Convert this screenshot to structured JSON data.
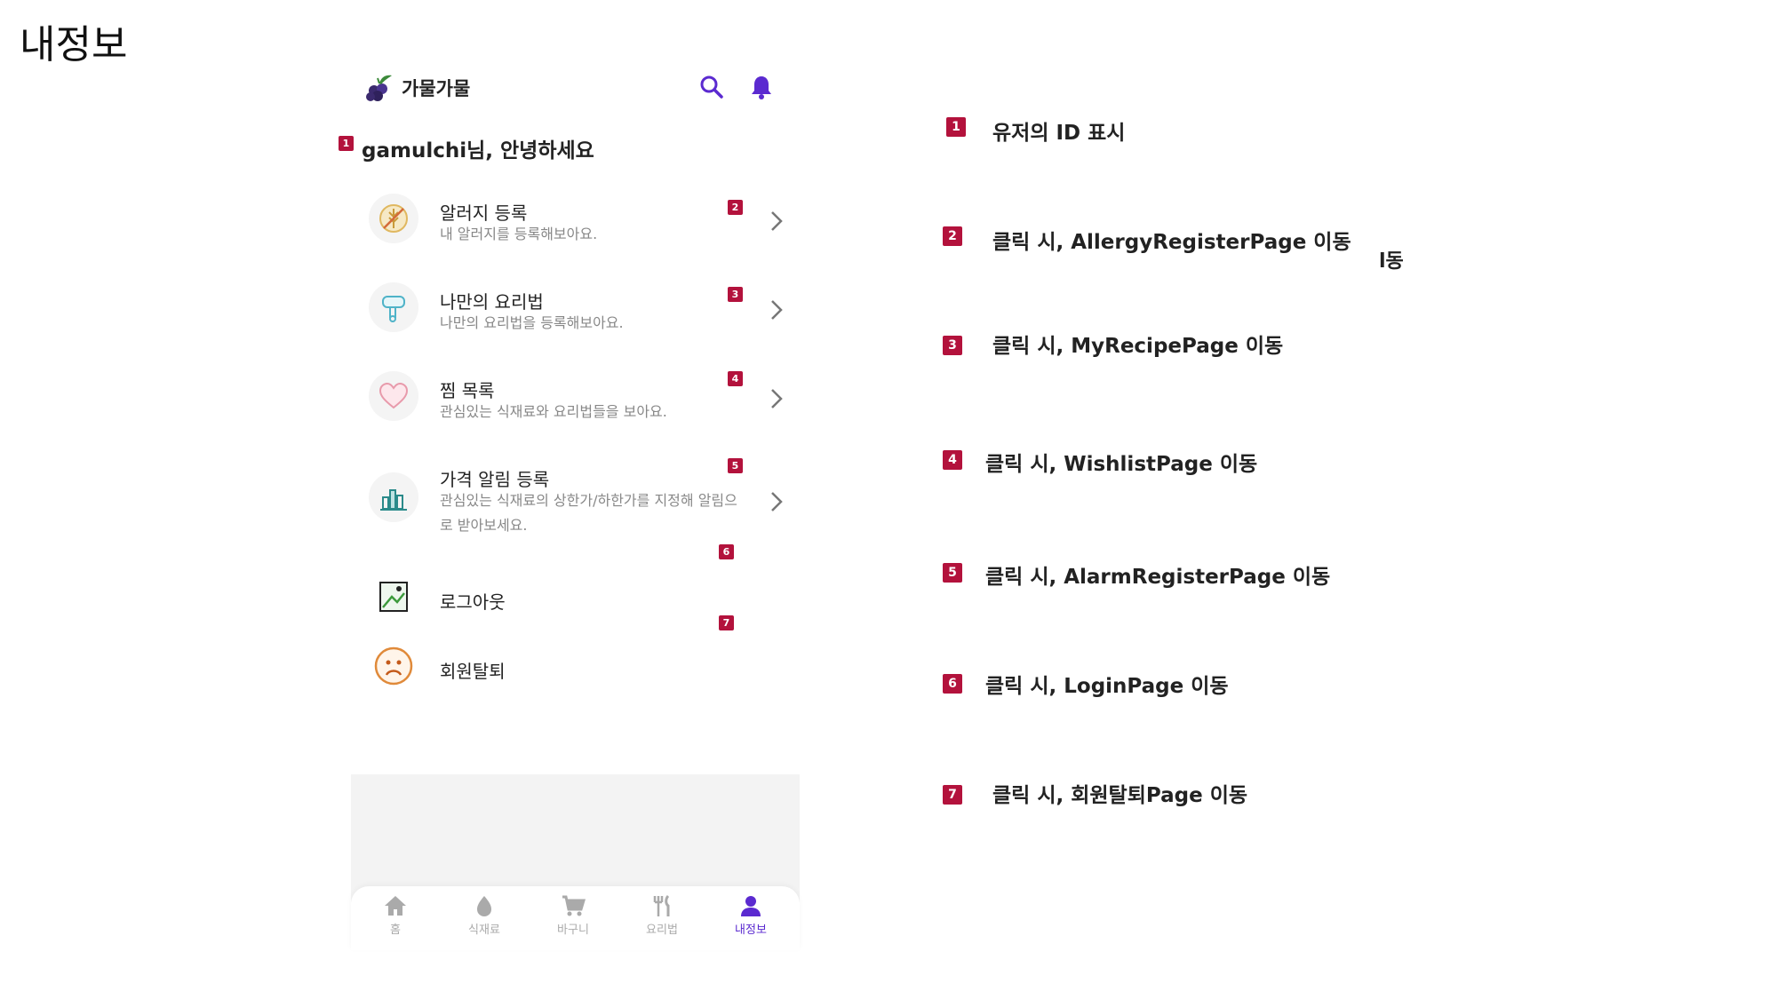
{
  "slide": {
    "title": "내정보"
  },
  "app": {
    "name": "가물가물",
    "greeting": "gamulchi님, 안녕하세요",
    "greeting_badge": "1"
  },
  "menu": [
    {
      "title": "알러지 등록",
      "subtitle": "내 알러지를 등록해보아요.",
      "badge": "2"
    },
    {
      "title": "나만의 요리법",
      "subtitle": "나만의 요리법을 등록해보아요.",
      "badge": "3"
    },
    {
      "title": "찜 목록",
      "subtitle": "관심있는 식재료와 요리법들을 보아요.",
      "badge": "4"
    },
    {
      "title": "가격 알림 등록",
      "subtitle": "관심있는 식재료의 상한가/하한가를 지정해 알림으로 받아보세요.",
      "badge": "5"
    },
    {
      "title": "로그아웃",
      "subtitle": "",
      "badge": "6"
    },
    {
      "title": "회원탈퇴",
      "subtitle": "",
      "badge": "7"
    }
  ],
  "tabs": [
    {
      "label": "홈",
      "icon": "home-icon"
    },
    {
      "label": "식재료",
      "icon": "ingredient-icon"
    },
    {
      "label": "바구니",
      "icon": "cart-icon"
    },
    {
      "label": "요리법",
      "icon": "utensils-icon"
    },
    {
      "label": "내정보",
      "icon": "user-icon",
      "active": true
    }
  ],
  "annotations": [
    {
      "badge": "1",
      "text": "유저의 ID 표시"
    },
    {
      "badge": "2",
      "text": "클릭 시, AllergyRegisterPage 이동"
    },
    {
      "badge": "3",
      "text": "클릭 시, MyRecipePage 이동"
    },
    {
      "badge": "4",
      "text": "클릭 시, WishlistPage 이동"
    },
    {
      "badge": "5",
      "text": "클릭 시, AlarmRegisterPage 이동"
    },
    {
      "badge": "6",
      "text": "클릭 시, LoginPage 이동"
    },
    {
      "badge": "7",
      "text": "클릭 시, 회원탈퇴Page 이동"
    }
  ],
  "ghost_text": {
    "a": "l동",
    "b": ""
  },
  "colors": {
    "accent": "#5b2ad0",
    "badge": "#b3123c",
    "inactive": "#aaaaaa"
  }
}
